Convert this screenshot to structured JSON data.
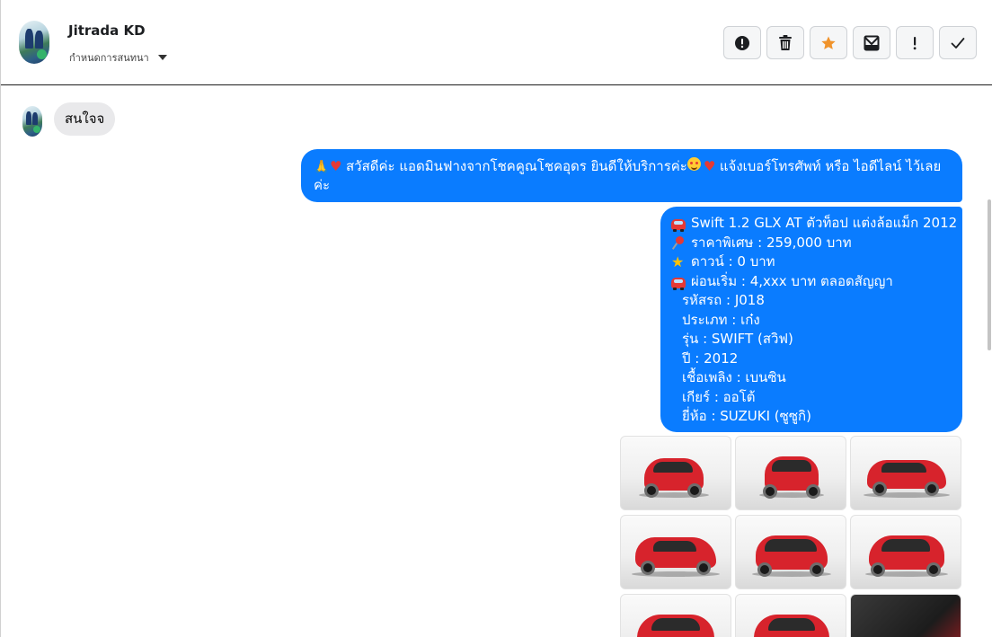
{
  "header": {
    "contact_name": "Jitrada KD",
    "assign_label": "กำหนดการสนทนา",
    "toolbar": [
      {
        "name": "report-button",
        "icon": "alert-circle-icon"
      },
      {
        "name": "delete-button",
        "icon": "trash-icon"
      },
      {
        "name": "star-button",
        "icon": "star-icon"
      },
      {
        "name": "mark-unread-button",
        "icon": "envelope-icon"
      },
      {
        "name": "important-button",
        "icon": "exclamation-icon"
      },
      {
        "name": "done-button",
        "icon": "check-icon"
      }
    ]
  },
  "messages": {
    "incoming_1": "สนใจจ",
    "outgoing_1": "สวัสดีค่ะ แอดมินฟางจากโชคคูณโชคอุดร ยินดีให้บริการค่ะ",
    "outgoing_1_tail": "แจ้งเบอร์โทรศัพท์ หรือ ไอดีไลน์  ไว้เลยค่ะ",
    "outgoing_2": {
      "title": "Swift 1.2 GLX AT ตัวท็อป แต่งล้อแม็ก 2012",
      "price": "ราคาพิเศษ : 259,000 บาท",
      "down": "ดาวน์ : 0 บาท",
      "installment": "ผ่อนเริ่ม : 4,xxx บาท ตลอดสัญญา",
      "code": "รหัสรถ : J018",
      "type": "ประเภท : เก๋ง",
      "model": "รุ่น : SWIFT (สวิฟ)",
      "year": "ปี : 2012",
      "fuel": "เชื้อเพลิง : เบนซิน",
      "gear": "เกียร์ : ออโต้",
      "brand": "ยี่ห้อ : SUZUKI (ซูซูกิ)"
    }
  },
  "colors": {
    "outgoing_bubble": "#0a7cff",
    "incoming_bubble": "#e9e9eb",
    "star_accent": "#f0932b",
    "car_red": "#d7232c"
  }
}
